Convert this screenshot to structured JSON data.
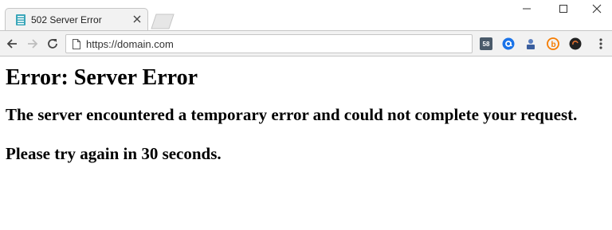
{
  "tab": {
    "title": "502 Server Error"
  },
  "address_bar": {
    "url": "https://domain.com"
  },
  "page": {
    "heading": "Error: Server Error",
    "message": "The server encountered a temporary error and could not complete your request.",
    "retry": "Please try again in 30 seconds."
  },
  "extensions": {
    "badge_text": "58"
  },
  "colors": {
    "toolbar_bg": "#f2f2f2",
    "favicon": "#3aa6b9",
    "ext_blue": "#1a73e8",
    "ext_orange": "#f57c00"
  }
}
